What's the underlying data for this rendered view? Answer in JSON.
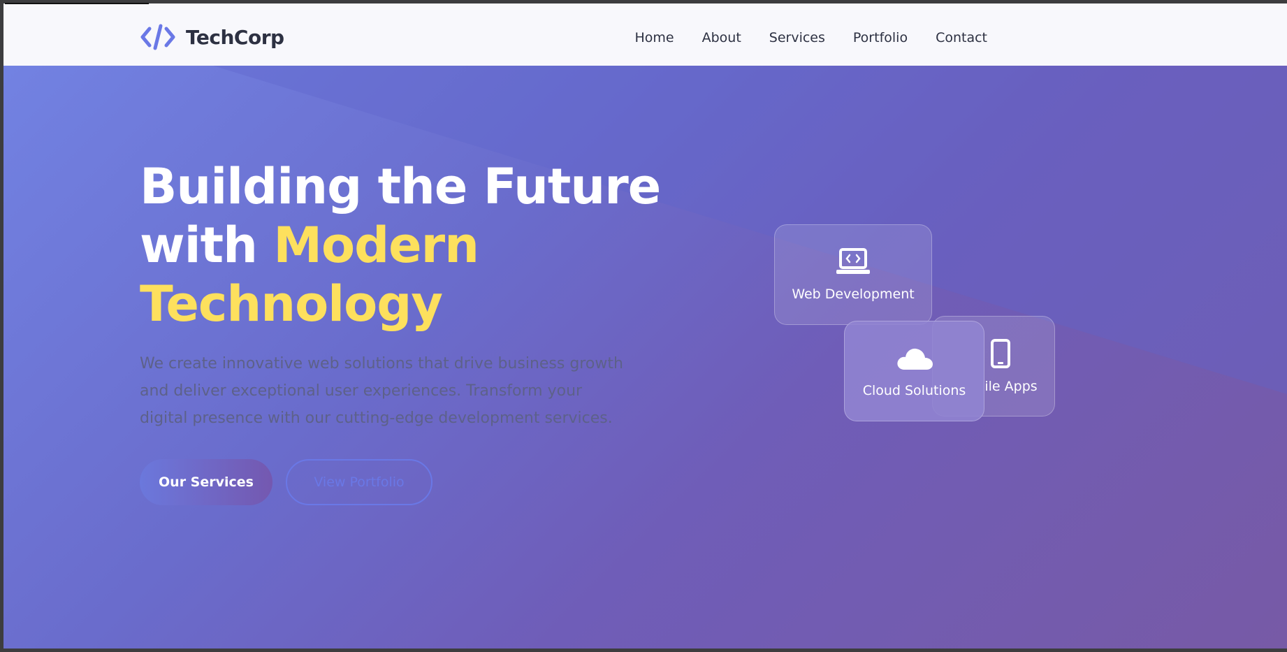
{
  "brand": {
    "name": "TechCorp",
    "logo_icon": "code-brackets-icon",
    "accent": "#6a78e6"
  },
  "nav": {
    "items": [
      {
        "label": "Home"
      },
      {
        "label": "About"
      },
      {
        "label": "Services"
      },
      {
        "label": "Portfolio"
      },
      {
        "label": "Contact"
      }
    ]
  },
  "hero": {
    "title_line1": "Building the Future",
    "title_line2_plain": "with ",
    "title_line2_accent": "Modern",
    "title_line3_accent": "Technology",
    "accent_color": "#fde05d",
    "description": "We create innovative web solutions that drive business growth and deliver exceptional user experiences. Transform your digital presence with our cutting-edge development services.",
    "primary_button": "Our Services",
    "secondary_button": "View Portfolio"
  },
  "cards": {
    "web": {
      "label": "Web Development",
      "icon": "laptop-code-icon"
    },
    "mobile": {
      "label": "Mobile Apps",
      "visible_text": "ile Apps",
      "icon": "mobile-phone-icon"
    },
    "cloud": {
      "label": "Cloud Solutions",
      "icon": "cloud-icon"
    }
  }
}
